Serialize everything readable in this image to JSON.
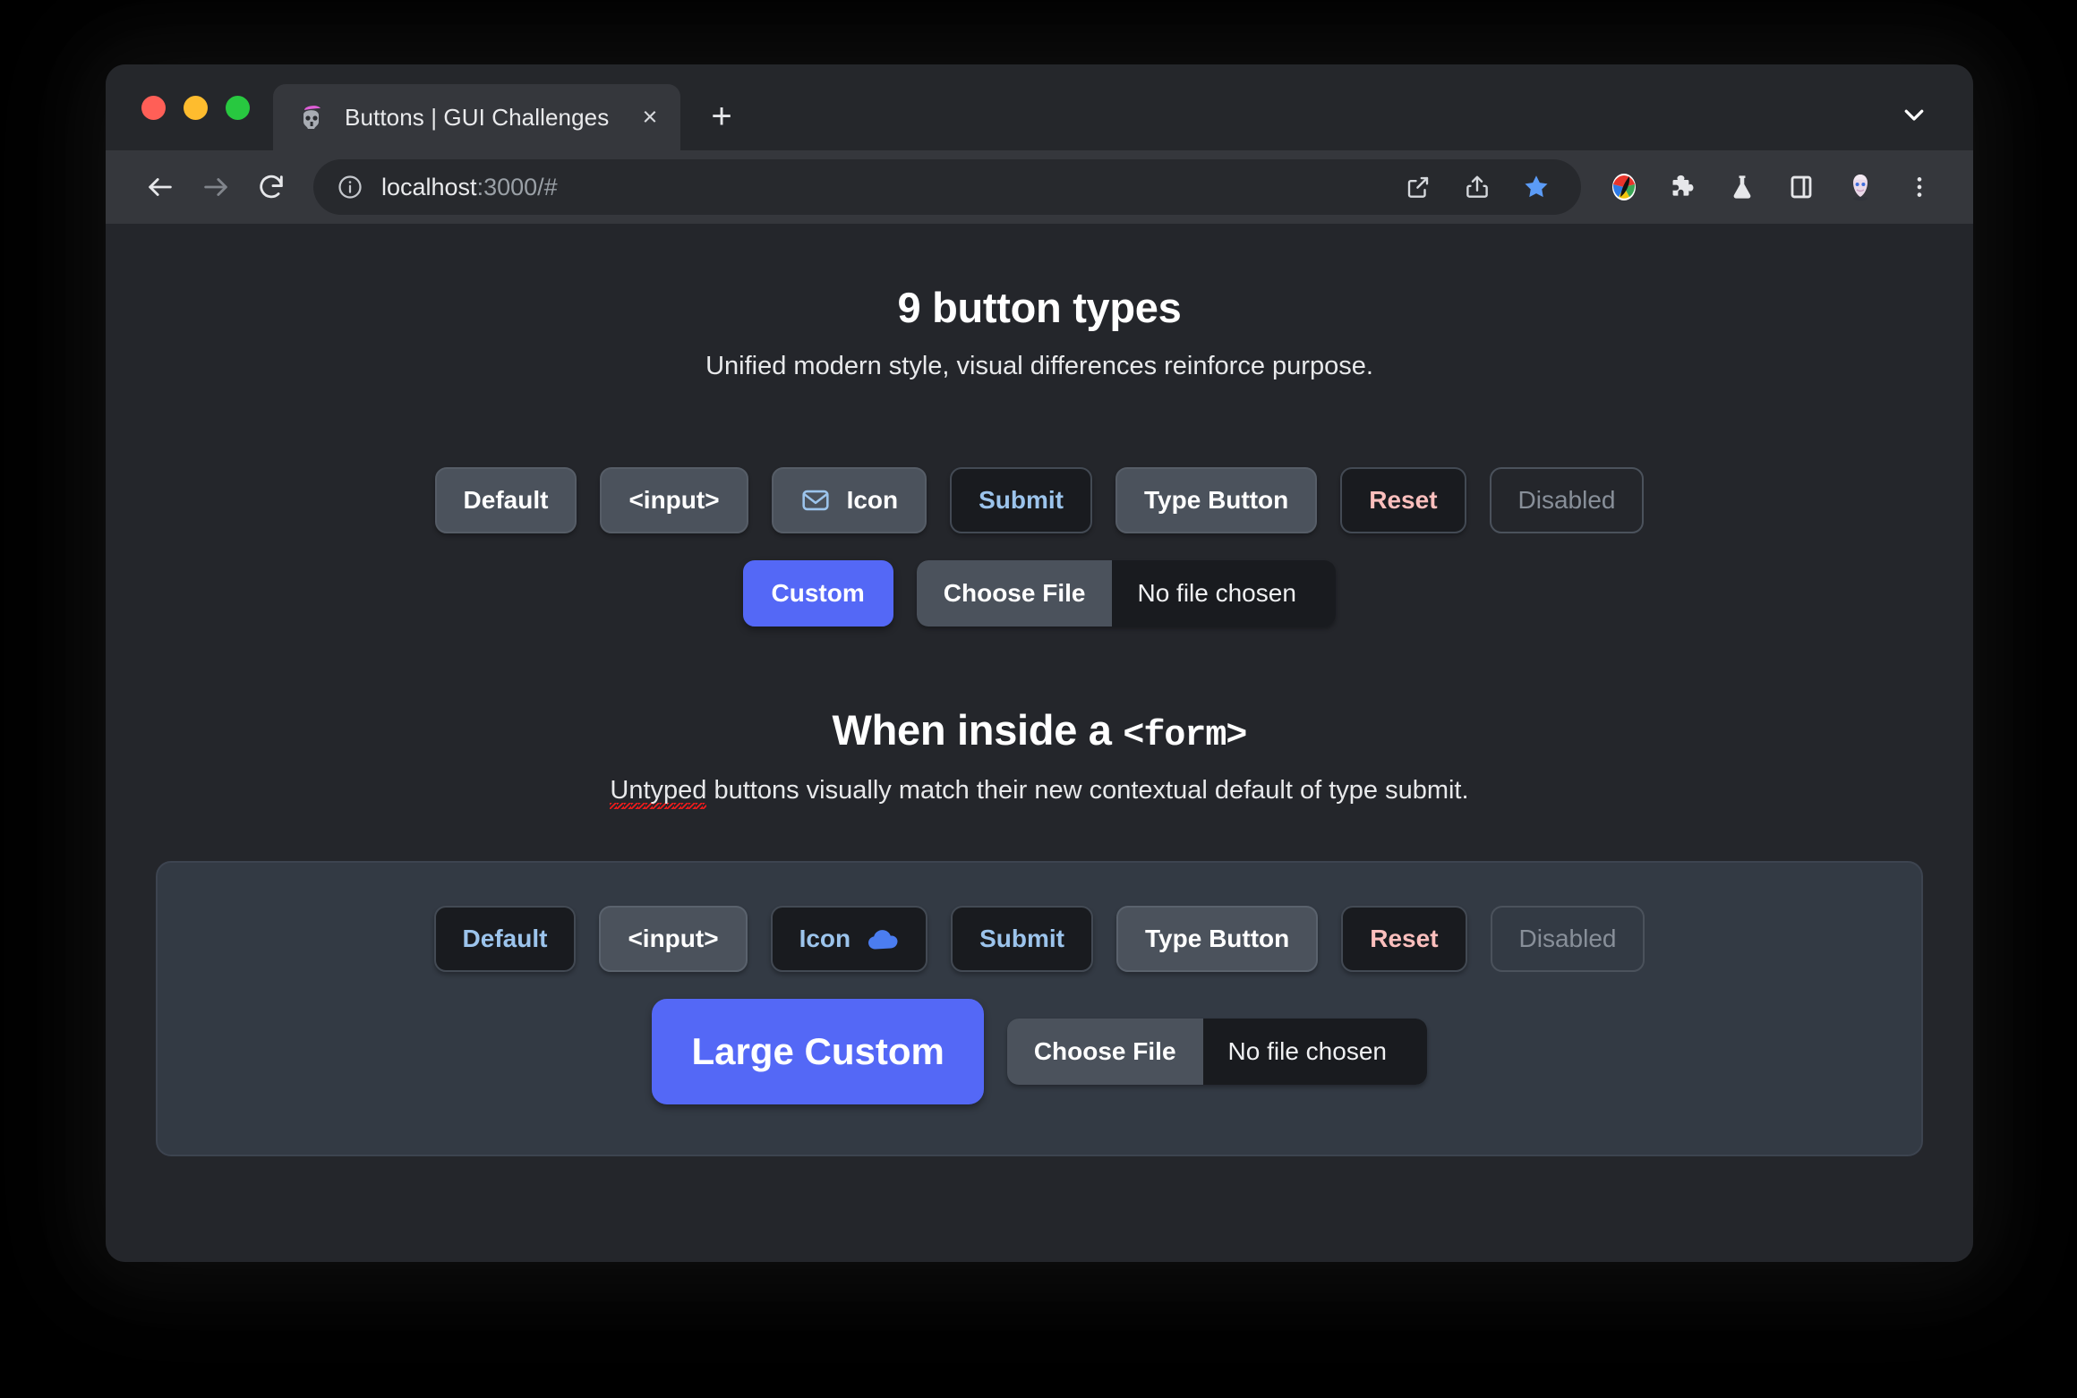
{
  "window": {
    "traffic_lights": [
      {
        "name": "close",
        "color": "#ff5f57"
      },
      {
        "name": "minimize",
        "color": "#febc2e"
      },
      {
        "name": "maximize",
        "color": "#28c840"
      }
    ]
  },
  "tab_strip": {
    "tab": {
      "title": "Buttons | GUI Challenges",
      "favicon": "skull-mohawk-favicon",
      "close_label": "×"
    },
    "new_tab_label": "+",
    "tab_list_icon": "chevron-down-icon"
  },
  "toolbar": {
    "nav_icons": [
      "back-arrow-icon",
      "forward-arrow-icon",
      "reload-icon"
    ],
    "omnibox": {
      "info_icon": "site-info-icon",
      "url_host": "localhost",
      "url_rest": ":3000/#"
    },
    "omnibox_actions": [
      "open-external-icon",
      "share-icon",
      "bookmark-star-icon"
    ],
    "extensions": [
      "color-wheel-extension-icon",
      "puzzle-extensions-icon",
      "flask-experiments-icon",
      "side-panel-icon",
      "profile-avatar-icon",
      "three-dot-menu-icon"
    ],
    "accent_colors": {
      "bookmark_star": "#5b9bf6",
      "link": "#9cc4ec"
    }
  },
  "page": {
    "sections": [
      {
        "title": "9 button types",
        "title_mono": "",
        "subtitle_prefix": "",
        "subtitle_spell": "",
        "subtitle": "Unified modern style, visual differences reinforce purpose."
      },
      {
        "title": "When inside a ",
        "title_mono": "<form>",
        "subtitle_spell": "Untyped",
        "subtitle_rest": " buttons visually match their new contextual default of type submit."
      }
    ],
    "standalone": {
      "row1": [
        {
          "label": "Default",
          "style": "neutral",
          "icon": null
        },
        {
          "label": "<input>",
          "style": "neutral",
          "icon": null
        },
        {
          "label": "Icon",
          "style": "neutral",
          "icon": "mail-envelope-icon",
          "icon_side": "left"
        },
        {
          "label": "Submit",
          "style": "dark",
          "icon": null
        },
        {
          "label": "Type Button",
          "style": "neutral",
          "icon": null
        },
        {
          "label": "Reset",
          "style": "dark-reset",
          "icon": null
        },
        {
          "label": "Disabled",
          "style": "disabled",
          "icon": null
        }
      ],
      "row2": {
        "custom_label": "Custom",
        "file_button_label": "Choose File",
        "file_status_label": "No file chosen"
      }
    },
    "form": {
      "row1": [
        {
          "label": "Default",
          "style": "dark",
          "icon": null
        },
        {
          "label": "<input>",
          "style": "neutral",
          "icon": null
        },
        {
          "label": "Icon",
          "style": "dark",
          "icon": "cloud-icon",
          "icon_side": "right"
        },
        {
          "label": "Submit",
          "style": "dark",
          "icon": null
        },
        {
          "label": "Type Button",
          "style": "neutral",
          "icon": null
        },
        {
          "label": "Reset",
          "style": "dark-reset",
          "icon": null
        },
        {
          "label": "Disabled",
          "style": "disabled",
          "icon": null
        }
      ],
      "row2": {
        "custom_label": "Large Custom",
        "file_button_label": "Choose File",
        "file_status_label": "No file chosen"
      }
    },
    "colors": {
      "page_bg": "#24262b",
      "neutral_button": "#4b525c",
      "dark_button": "#191b1f",
      "custom_accent": "#5468f6",
      "submit_text": "#9cc4ec",
      "reset_text": "#fbbfbd",
      "disabled_text": "#888f99",
      "form_card_bg": "#333a44"
    }
  }
}
